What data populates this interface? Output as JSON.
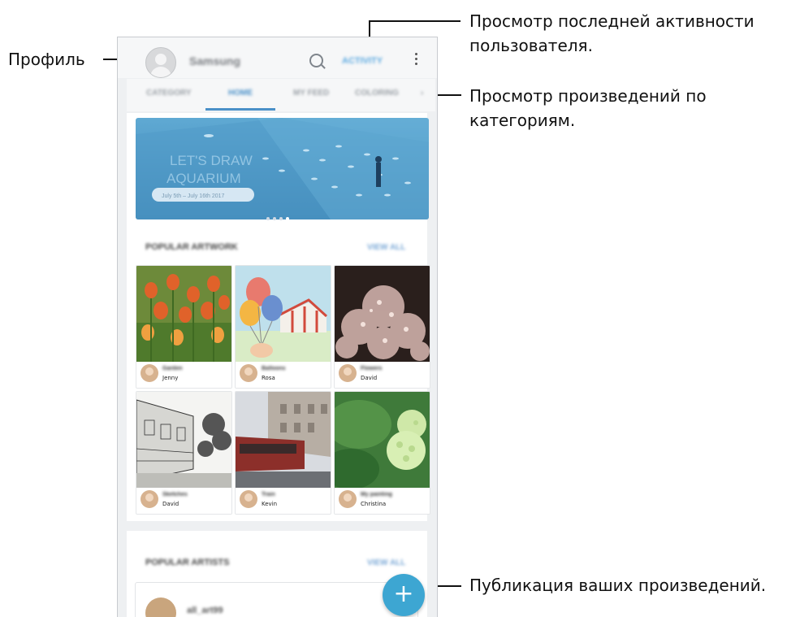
{
  "callouts": {
    "profile": "Профиль",
    "activity_line1": "Просмотр последней активности",
    "activity_line2": "пользователя.",
    "categories_line1": "Просмотр произведений по",
    "categories_line2": "категориям.",
    "publish": "Публикация ваших произведений."
  },
  "app": {
    "username": "Samsung",
    "activity_label": "ACTIVITY",
    "tabs": [
      {
        "label": "CATEGORY",
        "active": false
      },
      {
        "label": "HOME",
        "active": true
      },
      {
        "label": "MY FEED",
        "active": false
      },
      {
        "label": "COLORING",
        "active": false
      }
    ],
    "banner": {
      "title_line1": "LET'S DRAW",
      "title_line2": "AQUARIUM",
      "dates": "July 5th – July 16th 2017",
      "page_dots": 4,
      "active_dot": 4
    },
    "popular_artwork": {
      "title": "POPULAR ARTWORK",
      "view_all": "VIEW ALL",
      "cards": [
        {
          "title": "Garden",
          "author": "Jenny"
        },
        {
          "title": "Balloons",
          "author": "Rosa"
        },
        {
          "title": "Flowers",
          "author": "David"
        },
        {
          "title": "Sketches",
          "author": "David"
        },
        {
          "title": "Train",
          "author": "Kevin"
        },
        {
          "title": "My painting",
          "author": "Christina"
        }
      ]
    },
    "popular_artists": {
      "title": "POPULAR ARTISTS",
      "view_all": "VIEW ALL",
      "first_artist": "all_art99"
    },
    "fab_label": "+"
  },
  "colors": {
    "accent": "#3da6d2",
    "tab_active": "#4a90c8",
    "activity": "#5aa8e0"
  },
  "icons": [
    "profile-avatar-icon",
    "search-icon",
    "more-options-icon",
    "add-icon"
  ]
}
